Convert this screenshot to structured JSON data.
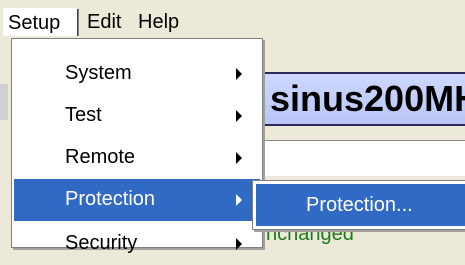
{
  "menubar": {
    "items": [
      {
        "label": "Setup",
        "open": true
      },
      {
        "label": "Edit"
      },
      {
        "label": "Help"
      }
    ]
  },
  "background": {
    "banner_text": "sinus200MH",
    "status_text": "nchanged"
  },
  "dropdown": {
    "items": [
      {
        "label": "System",
        "has_submenu": true
      },
      {
        "label": "Test",
        "has_submenu": true
      },
      {
        "label": "Remote",
        "has_submenu": true
      },
      {
        "label": "Protection",
        "has_submenu": true,
        "highlighted": true
      },
      {
        "label": "Security",
        "has_submenu": true
      }
    ]
  },
  "submenu": {
    "items": [
      {
        "label": "Protection...",
        "highlighted": true
      }
    ]
  },
  "colors": {
    "menu_background": "#ece9d8",
    "highlight": "#316ac5",
    "banner": "#c4cff9",
    "status_text": "#1d7a1d"
  }
}
